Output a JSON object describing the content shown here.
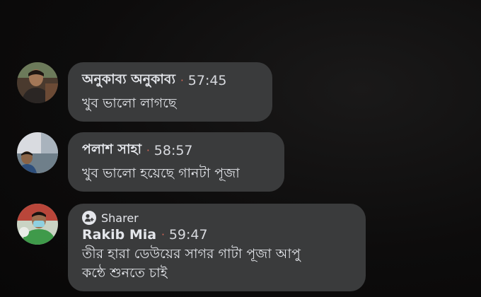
{
  "comments": [
    {
      "author": "অনুকাব্য অনুকাব্য",
      "separator": "·",
      "time": "57:45",
      "text": "খুব ভালো লাগছে"
    },
    {
      "author": "পলাশ সাহা",
      "separator": "·",
      "time": "58:57",
      "text": "খুব ভালো হয়েছে গানটা পূজা"
    },
    {
      "badge": "Sharer",
      "author": "Rakib Mia",
      "separator": "·",
      "time": "59:47",
      "text_line1": "তীর হারা ডেউয়ের সাগর গাটা পূজা আপু",
      "text_line2": "কন্ঠে শুনতে চাই"
    }
  ],
  "colors": {
    "background": "#0b0a0a",
    "bubble": "#3a3b3c",
    "text": "#e4e6eb",
    "separator_dot": "#e06a57"
  },
  "icons": [
    "avatar",
    "sharer-icon"
  ]
}
